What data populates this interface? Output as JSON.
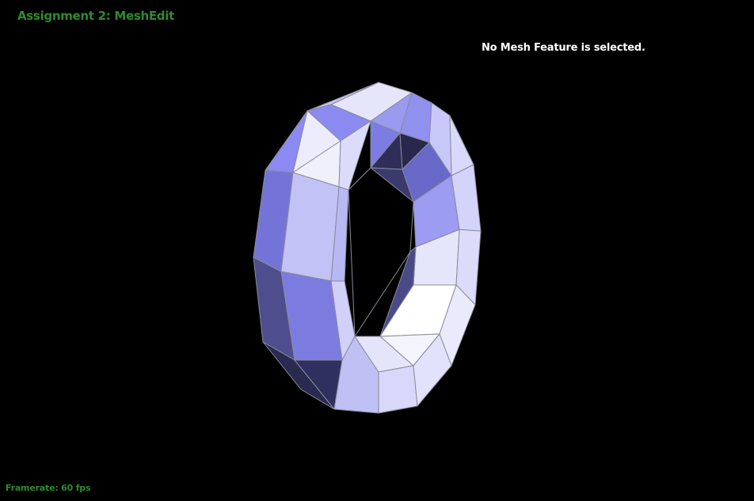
{
  "app": {
    "title": "Assignment 2: MeshEdit",
    "title_color": "#2e8b2e"
  },
  "status": {
    "message": "No Mesh Feature is selected.",
    "color": "#ffffff"
  },
  "footer": {
    "framerate_label": "Framerate: 60 fps",
    "color": "#2e8b2e"
  },
  "viewport": {
    "background": "#000000",
    "mesh": "torus",
    "edge_color": "#8a8a9a",
    "shade_colors": [
      "#ffffff",
      "#e8e8ff",
      "#c4c4f8",
      "#9a9af0",
      "#7474d8",
      "#4a4a88",
      "#28284e"
    ]
  }
}
